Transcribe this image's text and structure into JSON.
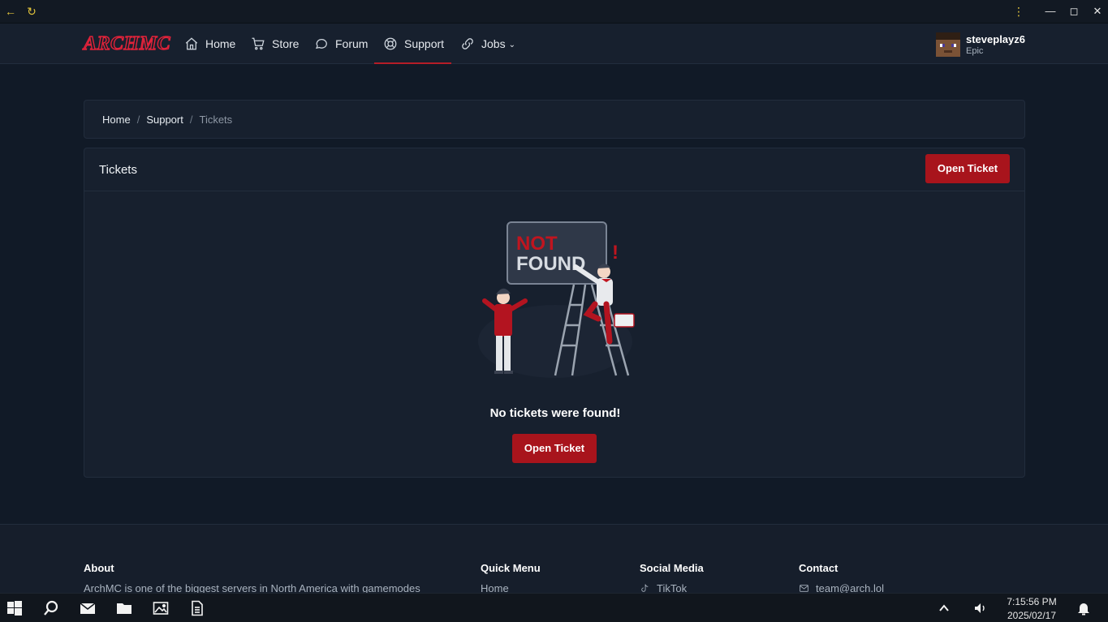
{
  "nav": {
    "logo": "ARCHMC",
    "items": [
      {
        "label": "Home",
        "icon": "home-icon"
      },
      {
        "label": "Store",
        "icon": "cart-icon"
      },
      {
        "label": "Forum",
        "icon": "chat-icon"
      },
      {
        "label": "Support",
        "icon": "lifebuoy-icon",
        "active": true
      },
      {
        "label": "Jobs",
        "icon": "link-icon",
        "dropdown": true
      }
    ],
    "user": {
      "name": "steveplayz6",
      "rank": "Epic"
    }
  },
  "breadcrumb": {
    "home": "Home",
    "support": "Support",
    "current": "Tickets",
    "separator": "/"
  },
  "tickets": {
    "title": "Tickets",
    "open_button": "Open Ticket",
    "illustration": {
      "line1": "NOT",
      "line2": "FOUND",
      "mark": "!"
    },
    "empty_message": "No tickets were found!",
    "empty_button": "Open Ticket"
  },
  "footer": {
    "about": {
      "heading": "About",
      "text": "ArchMC is one of the biggest servers in North America with gamemodes"
    },
    "quick_menu": {
      "heading": "Quick Menu",
      "first_link": "Home"
    },
    "social": {
      "heading": "Social Media",
      "first_link": "TikTok"
    },
    "contact": {
      "heading": "Contact",
      "email": "team@arch.lol"
    }
  },
  "taskbar": {
    "time": "7:15:56 PM",
    "date": "2025/02/17"
  },
  "colors": {
    "accent": "#a8141c",
    "background": "#111a27",
    "panel": "#17202e",
    "border": "#222d3d"
  }
}
